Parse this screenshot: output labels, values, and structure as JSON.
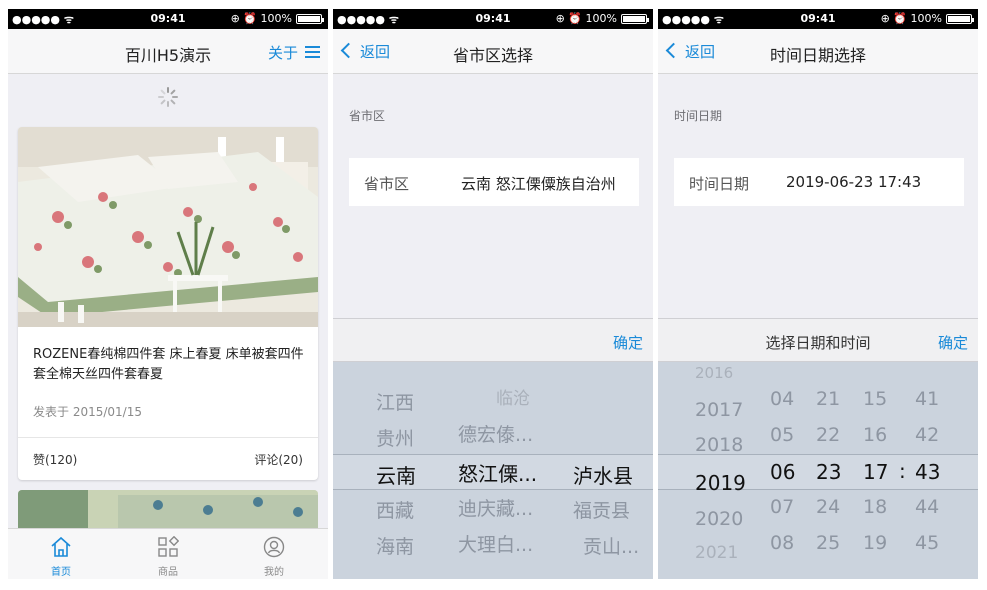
{
  "status": {
    "signal": "●●●●● ᯤ",
    "time": "09:41",
    "right": "⊕ ⏰ 100%"
  },
  "screen1": {
    "nav_title": "百川H5演示",
    "about": "关于",
    "card": {
      "title": "ROZENE春纯棉四件套 床上春夏 床单被套四件套全棉天丝四件套春夏",
      "date": "发表于 2015/01/15",
      "likes": "赞(120)",
      "comments": "评论(20)"
    },
    "tabs": [
      {
        "label": "首页",
        "icon": "home-icon"
      },
      {
        "label": "商品",
        "icon": "grid-icon"
      },
      {
        "label": "我的",
        "icon": "user-icon"
      }
    ],
    "accent": "#1a8ad8"
  },
  "screen2": {
    "back": "返回",
    "nav_title": "省市区选择",
    "section": "省市区",
    "field_key": "省市区",
    "field_value": "云南 怒江傈僳族自治州",
    "ok": "确定",
    "col1": [
      "江西",
      "贵州",
      "云南",
      "西藏",
      "海南"
    ],
    "col2": [
      "临沧",
      "德宏傣...",
      "怒江傈...",
      "迪庆藏...",
      "大理白..."
    ],
    "col3": [
      "泸水县",
      "福贡县",
      "贡山..."
    ]
  },
  "screen3": {
    "back": "返回",
    "nav_title": "时间日期选择",
    "section": "时间日期",
    "field_key": "时间日期",
    "field_value": "2019-06-23 17:43",
    "toolbar_title": "选择日期和时间",
    "ok": "确定",
    "years": [
      "2016",
      "2017",
      "2018",
      "2019",
      "2020",
      "2021"
    ],
    "months": [
      "04",
      "05",
      "06",
      "07",
      "08"
    ],
    "days": [
      "21",
      "22",
      "23",
      "24",
      "25"
    ],
    "hours": [
      "15",
      "16",
      "17",
      "18",
      "19"
    ],
    "separator": ":",
    "minutes": [
      "41",
      "42",
      "43",
      "44",
      "45"
    ]
  }
}
